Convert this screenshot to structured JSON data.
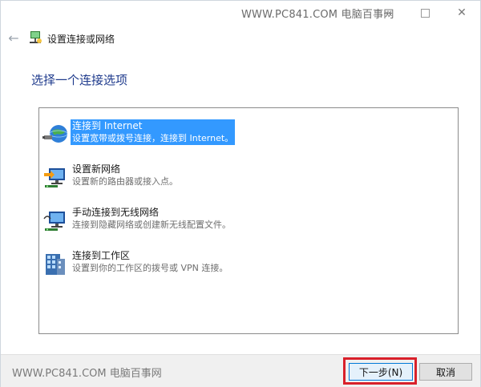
{
  "window": {
    "watermark_top": "WWW.PC841.COM 电脑百事网",
    "minimize_icon": "minimize-icon",
    "maximize_icon": "maximize-icon",
    "close_icon": "close-icon",
    "close_glyph": "✕"
  },
  "nav": {
    "back_glyph": "←",
    "title": "设置连接或网络"
  },
  "heading": "选择一个连接选项",
  "options": [
    {
      "title": "连接到 Internet",
      "desc": "设置宽带或拨号连接，连接到 Internet。",
      "selected": true
    },
    {
      "title": "设置新网络",
      "desc": "设置新的路由器或接入点。",
      "selected": false
    },
    {
      "title": "手动连接到无线网络",
      "desc": "连接到隐藏网络或创建新无线配置文件。",
      "selected": false
    },
    {
      "title": "连接到工作区",
      "desc": "设置到你的工作区的拨号或 VPN 连接。",
      "selected": false
    }
  ],
  "footer": {
    "watermark_bottom": "WWW.PC841.COM 电脑百事网",
    "next_label": "下一步(N)",
    "cancel_label": "取消"
  },
  "colors": {
    "selection": "#3399ff",
    "heading": "#1e3a8c",
    "highlight_box": "#d9202a"
  }
}
